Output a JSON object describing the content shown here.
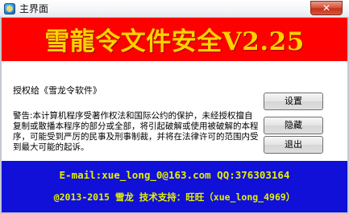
{
  "window": {
    "title": "主界面",
    "close_label": "✕"
  },
  "banner": {
    "text": "雪龍令文件安全V2.25"
  },
  "content": {
    "license_label": "授权给《雪龙令软件》",
    "warning": "警告:本计算机程序受著作权法和国际公约的保护，未经授权擅自复制或散播本程序的部分或全部，将引起破解或使用被破解的本程序，可能受到严厉的民事及刑事制裁，并将在法律许可的范围内受到最大可能的起诉。"
  },
  "buttons": {
    "settings": "设置",
    "hide": "隐藏",
    "exit": "退出"
  },
  "footer": {
    "line1": "E-mail:xue_long_0@163.com QQ:376303164",
    "line2": "@2013-2015 雪龙 技术支持：旺旺（xue_long_4969）"
  },
  "colors": {
    "banner_bg": "#ff0000",
    "banner_text": "#ffd200",
    "footer_bg": "#1010d8",
    "footer_text": "#e3f000"
  }
}
